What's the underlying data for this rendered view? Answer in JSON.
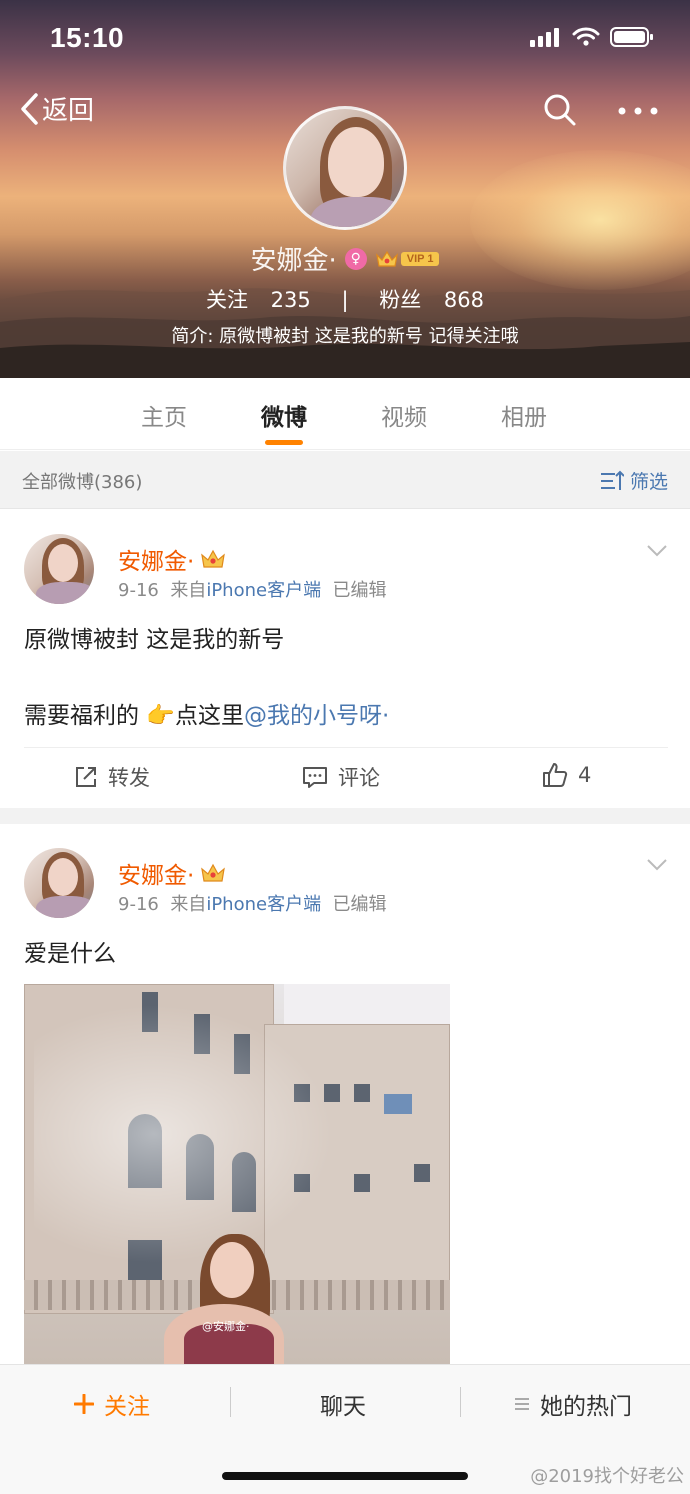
{
  "status_bar": {
    "time": "15:10"
  },
  "nav": {
    "back_label": "返回"
  },
  "profile": {
    "name": "安娜金·",
    "vip_label": "VIP 1",
    "following_label": "关注",
    "following_count": "235",
    "separator": "|",
    "followers_label": "粉丝",
    "followers_count": "868",
    "bio": "简介: 原微博被封 这是我的新号 记得关注哦"
  },
  "tabs": [
    {
      "label": "主页",
      "active": false
    },
    {
      "label": "微博",
      "active": true
    },
    {
      "label": "视频",
      "active": false
    },
    {
      "label": "相册",
      "active": false
    }
  ],
  "filter_bar": {
    "count_label": "全部微博(386)",
    "filter_label": "筛选"
  },
  "posts": [
    {
      "author": "安娜金·",
      "date": "9-16",
      "source_prefix": "来自",
      "source": "iPhone客户端",
      "edited": "已编辑",
      "line1": "原微博被封 这是我的新号",
      "line2_prefix": "需要福利的 ",
      "emoji": "👉",
      "line2_mid": "点这里",
      "mention": "@我的小号呀·",
      "actions": {
        "repost": "转发",
        "comment": "评论",
        "like_count": "4"
      }
    },
    {
      "author": "安娜金·",
      "date": "9-16",
      "source_prefix": "来自",
      "source": "iPhone客户端",
      "edited": "已编辑",
      "text": "爱是什么",
      "image_watermark": "@安娜金·"
    }
  ],
  "bottom_bar": {
    "follow": "关注",
    "chat": "聊天",
    "hot": "她的热门"
  },
  "page_watermark": "@2019找个好老公",
  "colors": {
    "accent": "#ff8200",
    "link": "#4b78b0",
    "name": "#f05a00"
  }
}
